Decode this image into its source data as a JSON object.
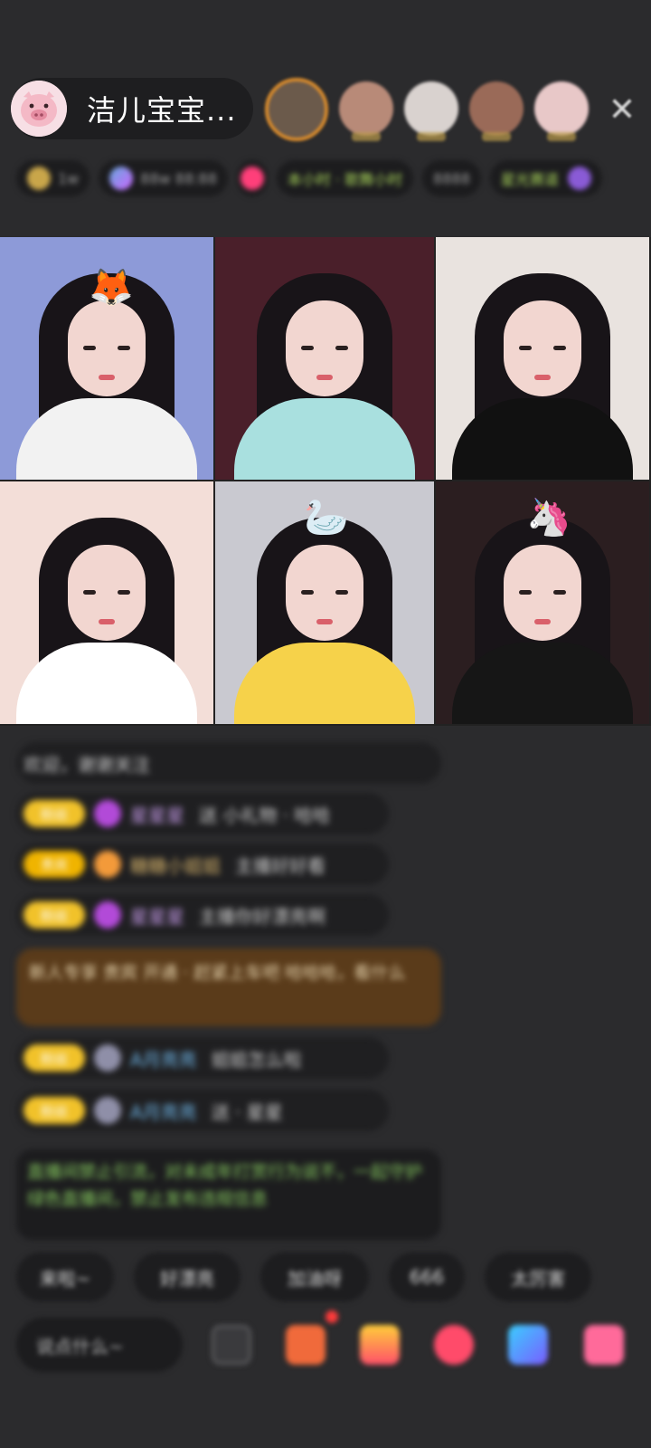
{
  "header": {
    "host_name": "洁儿宝宝...",
    "close_label": "✕",
    "viewer_count": 5
  },
  "info_row": {
    "chips": [
      "1w",
      "88w 88:88",
      "",
      "本小时 · 歌舞小时",
      "8888",
      "星光赛道"
    ]
  },
  "video_grid": {
    "tiles": [
      {
        "bg": "#8d9ad8",
        "body": "#f2f2f2",
        "sticker": "🦊"
      },
      {
        "bg": "#4a1f2a",
        "body": "#a9e0df",
        "sticker": ""
      },
      {
        "bg": "#e9e3df",
        "body": "#111111",
        "sticker": ""
      },
      {
        "bg": "#f3ded8",
        "body": "#ffffff",
        "sticker": ""
      },
      {
        "bg": "#c9c9d0",
        "body": "#f6d24a",
        "sticker": "🦢"
      },
      {
        "bg": "#2b1e20",
        "body": "#161616",
        "sticker": "🦄"
      }
    ]
  },
  "chat": {
    "system_text": "欢迎，谢谢关注",
    "messages": [
      {
        "badge": "粉丝",
        "user": "星星星",
        "text": "送 小礼物 · 哈哈"
      },
      {
        "badge": "贵宾",
        "user": "糖糖小姐姐",
        "text": "主播好好看"
      },
      {
        "badge": "粉丝",
        "user": "星星星",
        "text": "主播你好漂亮啊"
      },
      {
        "badge": "粉丝",
        "user": "A月亮亮",
        "text": "姐姐怎么啦"
      },
      {
        "badge": "粉丝",
        "user": "A月亮亮",
        "text": "送 · 星星"
      }
    ],
    "promo_text": "新人专享 贵宾 开通 · 赶紧上车吧 哈哈哈，看什么",
    "notice_text": "直播间禁止引流，对未成年打赏行为说不，一起守护绿色直播间，禁止发布违规信息"
  },
  "quick_replies": [
    "来啦~",
    "好漂亮",
    "加油呀",
    "666",
    "太厉害"
  ],
  "bottom_bar": {
    "input_placeholder": "说点什么~"
  },
  "colors": {
    "background": "#2b2b2d",
    "badge": "#f1c22a",
    "promo": "#5a3b1a",
    "notice_text": "#86c95f"
  }
}
